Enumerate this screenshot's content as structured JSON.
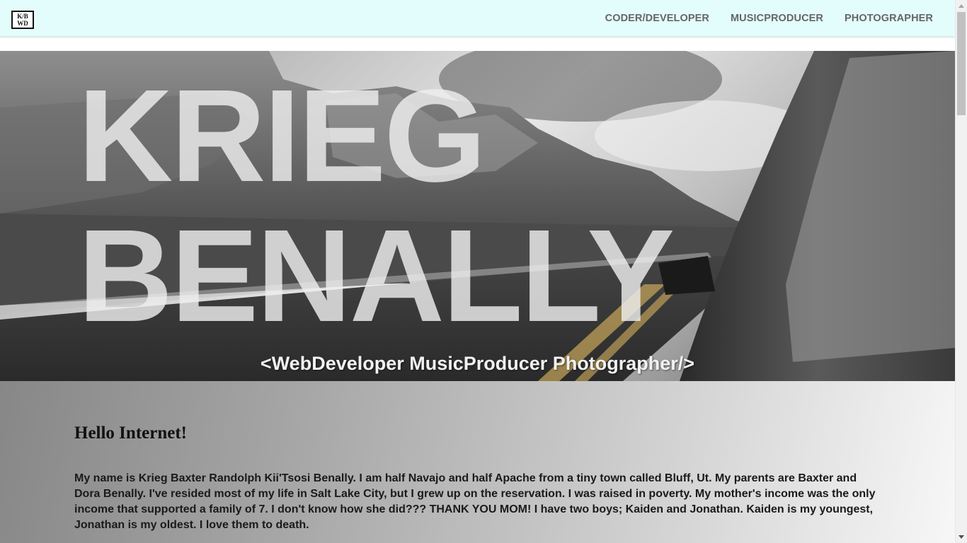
{
  "navbar": {
    "logo_line1": "K/B",
    "logo_line2": "WD",
    "links": [
      "CODER/DEVELOPER",
      "MUSICPRODUCER",
      "PHOTOGRAPHER"
    ]
  },
  "hero": {
    "title_line1": "KRIEG",
    "title_line2": "BENALLY",
    "subtitle": "<WebDeveloper MusicProducer Photographer/>"
  },
  "intro": {
    "heading": "Hello Internet!",
    "paragraph": "My name is Krieg Baxter Randolph Kii'Tsosi Benally. I am half Navajo and half Apache from a tiny town called Bluff, Ut. My parents are Baxter and Dora Benally. I've resided most of my life in Salt Lake City, but I grew up on the reservation. I was raised in poverty. My mother's income was the only income that supported a family of 7. I don't know how she did??? THANK YOU MOM! I have two boys; Kaiden and Jonathan. Kaiden is my youngest, Jonathan is my oldest. I love them to death."
  },
  "colors": {
    "navbar_bg": "#e3fcfc",
    "nav_link": "#666666"
  }
}
